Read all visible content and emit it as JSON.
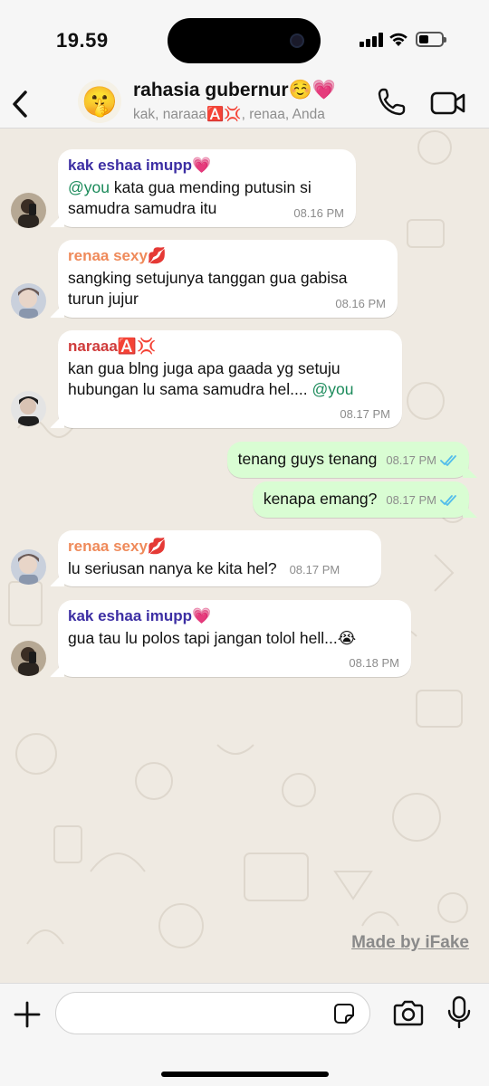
{
  "status_bar": {
    "time": "19.59",
    "battery_level": 0.45
  },
  "header": {
    "title": "rahasia gubernur☺️💗",
    "subtitle": "kak, naraaa🅰️💢, renaa, Anda",
    "group_avatar_emoji": "🤫"
  },
  "messages": [
    {
      "direction": "in",
      "sender": "kak eshaa imupp💗",
      "sender_color": "#3c2ea3",
      "mention": "@you",
      "text": " kata gua mending putusin si samudra samudra itu",
      "time": "08.16 PM"
    },
    {
      "direction": "in",
      "sender": "renaa sexy💋",
      "sender_color": "#ef8a5a",
      "text": "sangking setujunya tanggan gua gabisa turun jujur",
      "time": "08.16 PM"
    },
    {
      "direction": "in",
      "sender": "naraaa🅰️💢",
      "sender_color": "#cf3b3b",
      "text": "kan gua blng juga apa gaada yg setuju hubungan lu sama samudra hel.... ",
      "mention_end": "@you",
      "time": "08.17 PM"
    },
    {
      "direction": "out",
      "text": "tenang guys tenang",
      "time": "08.17 PM",
      "status": "read"
    },
    {
      "direction": "out",
      "text": "kenapa emang?",
      "time": "08.17 PM",
      "status": "read"
    },
    {
      "direction": "in",
      "sender": "renaa sexy💋",
      "sender_color": "#ef8a5a",
      "text": "lu seriusan nanya ke kita hel?",
      "time": "08.17 PM"
    },
    {
      "direction": "in",
      "sender": "kak eshaa imupp💗",
      "sender_color": "#3c2ea3",
      "text": "gua tau lu polos tapi jangan tolol hell...😭",
      "time": "08.18 PM"
    }
  ],
  "watermark": "Made by iFake",
  "composer": {
    "placeholder": ""
  },
  "colors": {
    "accent_tick": "#53bdeb",
    "outgoing_bubble": "#d9fdd3",
    "chat_background": "#efeae2"
  },
  "icons": [
    "back-chevron-icon",
    "phone-icon",
    "video-icon",
    "plus-icon",
    "sticker-icon",
    "camera-icon",
    "microphone-icon",
    "double-check-icon"
  ]
}
